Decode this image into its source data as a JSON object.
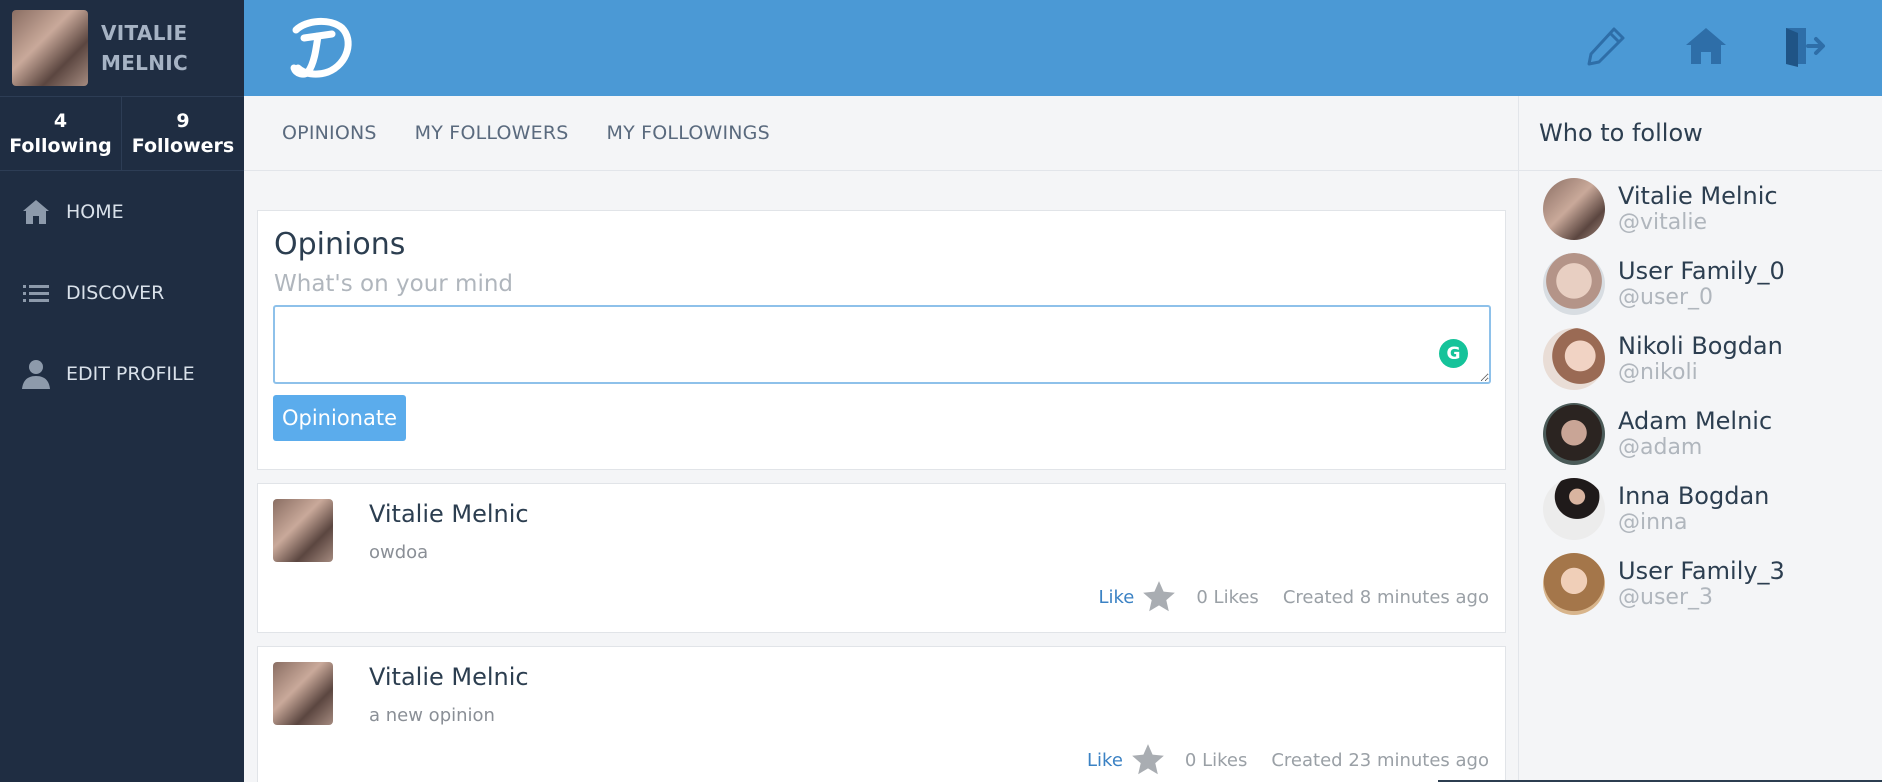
{
  "sidebar": {
    "profile_name_line1": "VITALIE",
    "profile_name_line2": "MELNIC",
    "following_count": "4",
    "following_label": "Following",
    "followers_count": "9",
    "followers_label": "Followers",
    "nav": [
      {
        "label": "HOME",
        "icon": "home-icon"
      },
      {
        "label": "DISCOVER",
        "icon": "list-icon"
      },
      {
        "label": "EDIT PROFILE",
        "icon": "user-icon"
      }
    ]
  },
  "topbar": {
    "accent": "#4b99d5",
    "icons": [
      "pencil-icon",
      "home-icon",
      "logout-icon"
    ]
  },
  "tabs": [
    "OPINIONS",
    "MY FOLLOWERS",
    "MY FOLLOWINGS"
  ],
  "composer": {
    "title": "Opinions",
    "hint": "What's on your mind",
    "textarea_value": "",
    "button_label": "Opinionate"
  },
  "posts": [
    {
      "author": "Vitalie Melnic",
      "text": "owdoa",
      "like_label": "Like",
      "likes": "0 Likes",
      "created": "Created 8 minutes ago"
    },
    {
      "author": "Vitalie Melnic",
      "text": "a new opinion",
      "like_label": "Like",
      "likes": "0 Likes",
      "created": "Created 23 minutes ago"
    }
  ],
  "who_to_follow": {
    "title": "Who to follow",
    "users": [
      {
        "name": "Vitalie Melnic",
        "handle": "@vitalie"
      },
      {
        "name": "User Family_0",
        "handle": "@user_0"
      },
      {
        "name": "Nikoli Bogdan",
        "handle": "@nikoli"
      },
      {
        "name": "Adam Melnic",
        "handle": "@adam"
      },
      {
        "name": "Inna Bogdan",
        "handle": "@inna"
      },
      {
        "name": "User Family_3",
        "handle": "@user_3"
      }
    ]
  }
}
